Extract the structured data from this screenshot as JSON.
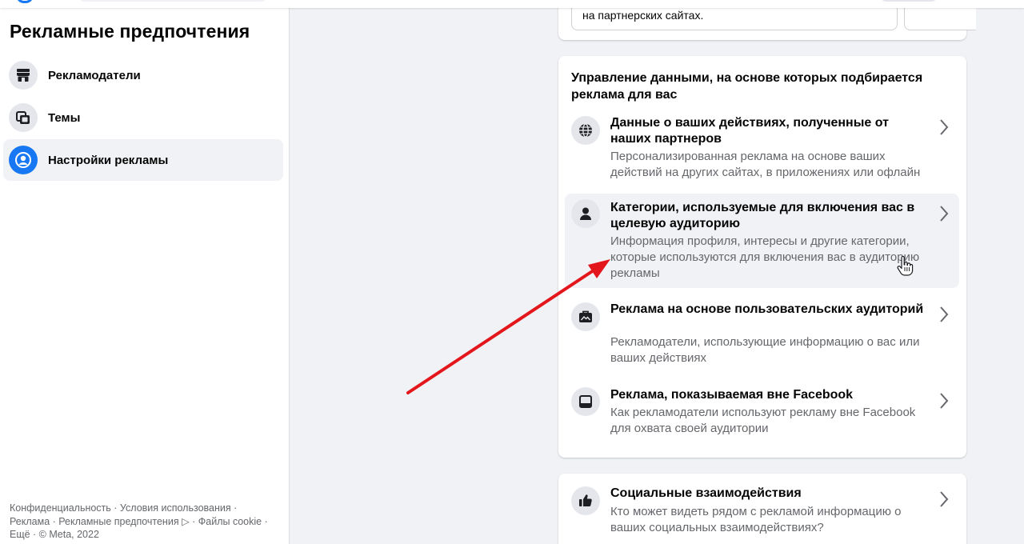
{
  "sidebar": {
    "title": "Рекламные предпочтения",
    "items": [
      {
        "label": "Рекламодатели",
        "icon": "store-icon"
      },
      {
        "label": "Темы",
        "icon": "topics-icon"
      },
      {
        "label": "Настройки рекламы",
        "icon": "user-circle-icon",
        "active": true
      }
    ],
    "footer": {
      "line1": "Конфиденциальность · Условия использования ·",
      "line2": "Реклама · Рекламные предпочтения ▷ · Файлы cookie ·",
      "line3": "Ещё · © Meta, 2022"
    }
  },
  "top_card": {
    "text": "на партнерских сайтах."
  },
  "main_card": {
    "title": "Управление данными, на основе которых подбирается реклама для вас",
    "rows": [
      {
        "icon": "globe-icon",
        "title": "Данные о ваших действиях, полученные от наших партнеров",
        "desc": "Персонализированная реклама на основе ваших действий на других сайтах, в приложениях или офлайн"
      },
      {
        "icon": "person-icon",
        "title": "Категории, используемые для включения вас в целевую аудиторию",
        "desc": "Информация профиля, интересы и другие категории, которые используются для включения вас в аудиторию рекламы"
      },
      {
        "icon": "briefcase-icon",
        "title": "Реклама на основе пользовательских аудиторий",
        "desc": "Рекламодатели, использующие информацию о вас или ваших действиях"
      },
      {
        "icon": "laptop-icon",
        "title": "Реклама, показываемая вне Facebook",
        "desc": "Как рекламодатели используют рекламу вне Facebook для охвата своей аудитории"
      }
    ]
  },
  "social_card": {
    "icon": "thumbs-up-icon",
    "title": "Социальные взаимодействия",
    "desc": "Кто может видеть рядом с рекламой информацию о ваших социальных взаимодействиях?"
  },
  "colors": {
    "accent": "#1877f2",
    "annotation_arrow": "#e3161c",
    "hover_bg": "#f0f2f5",
    "secondary_text": "#65676b"
  }
}
